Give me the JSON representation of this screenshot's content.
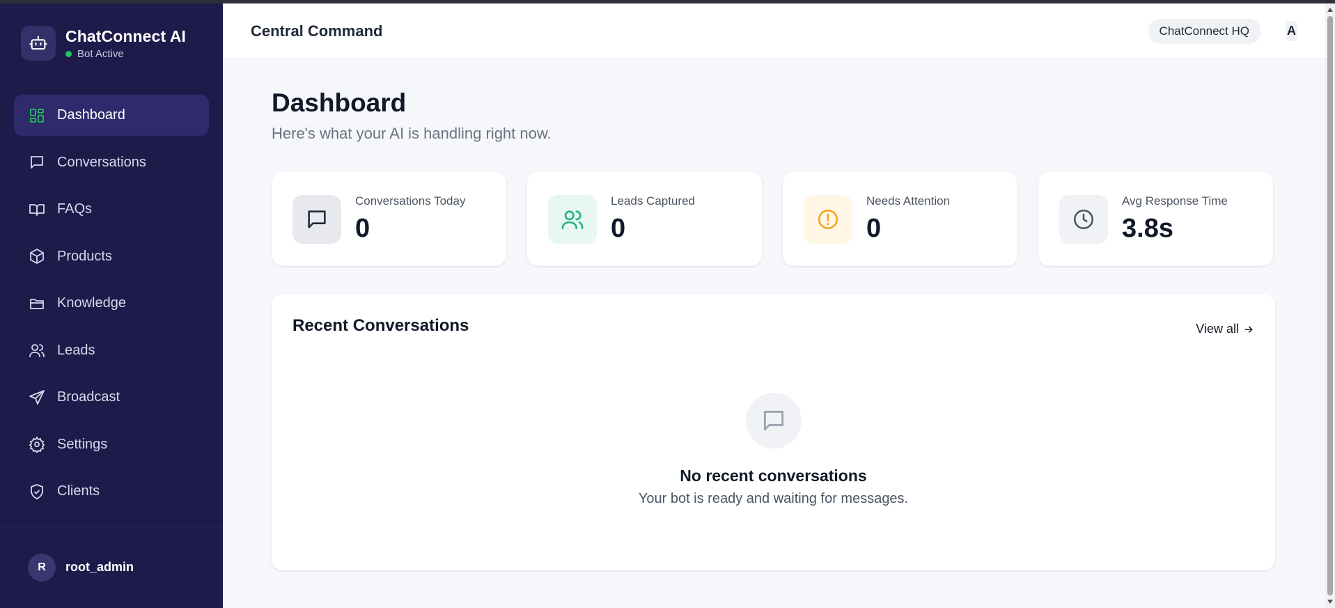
{
  "brand": {
    "name": "ChatConnect AI",
    "status": "Bot Active"
  },
  "nav": {
    "items": [
      {
        "label": "Dashboard",
        "icon": "dashboard-icon",
        "active": true
      },
      {
        "label": "Conversations",
        "icon": "chat-icon"
      },
      {
        "label": "FAQs",
        "icon": "book-icon"
      },
      {
        "label": "Products",
        "icon": "box-icon"
      },
      {
        "label": "Knowledge",
        "icon": "folder-icon"
      },
      {
        "label": "Leads",
        "icon": "users-icon"
      },
      {
        "label": "Broadcast",
        "icon": "send-icon"
      },
      {
        "label": "Settings",
        "icon": "gear-icon"
      },
      {
        "label": "Clients",
        "icon": "shield-icon"
      }
    ]
  },
  "footer": {
    "initial": "R",
    "username": "root_admin"
  },
  "header": {
    "title": "Central Command",
    "workspace": "ChatConnect HQ",
    "user_initial": "A"
  },
  "page": {
    "title": "Dashboard",
    "subtitle": "Here's what your AI is handling right now."
  },
  "stats": [
    {
      "label": "Conversations Today",
      "value": "0",
      "icon": "chat-icon",
      "color": "#1f2937",
      "bg": "#e8e9ef"
    },
    {
      "label": "Leads Captured",
      "value": "0",
      "icon": "users-icon",
      "color": "#22b07d",
      "bg": "#e8f7f0"
    },
    {
      "label": "Needs Attention",
      "value": "0",
      "icon": "alert-icon",
      "color": "#f2a516",
      "bg": "#fff6e6"
    },
    {
      "label": "Avg Response Time",
      "value": "3.8s",
      "icon": "clock-icon",
      "color": "#4b5563",
      "bg": "#f1f2f6"
    }
  ],
  "recent": {
    "title": "Recent Conversations",
    "view_all": "View all",
    "empty_title": "No recent conversations",
    "empty_subtitle": "Your bot is ready and waiting for messages."
  },
  "colors": {
    "sidebar": "#1e1b4b",
    "active_item": "#2e2a6b",
    "accent": "#22c55e"
  }
}
